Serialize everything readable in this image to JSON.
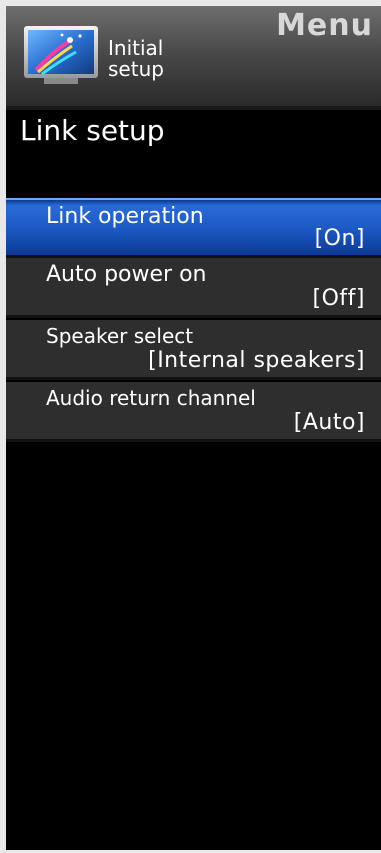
{
  "header": {
    "menu_title": "Menu",
    "section_line1": "Initial",
    "section_line2": "setup",
    "icon": "initial-setup-wand-icon"
  },
  "page": {
    "title": "Link setup"
  },
  "items": [
    {
      "label": "Link operation",
      "value": "[On]",
      "selected": true
    },
    {
      "label": "Auto power on",
      "value": "[Off]",
      "selected": false
    },
    {
      "label": "Speaker select",
      "value": "[Internal speakers]",
      "selected": false
    },
    {
      "label": "Audio return channel",
      "value": "[Auto]",
      "selected": false
    }
  ],
  "colors": {
    "selected_accent": "#1c5bc6",
    "item_background": "#2e2e2e",
    "screen_background": "#000000"
  }
}
